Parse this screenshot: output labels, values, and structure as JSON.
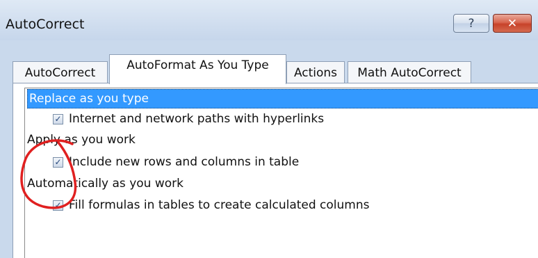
{
  "window": {
    "title": "AutoCorrect"
  },
  "titlebar_buttons": {
    "help_label": "?",
    "close_label": "✕"
  },
  "tabs": [
    {
      "label": "AutoCorrect",
      "active": false
    },
    {
      "label": "AutoFormat As You Type",
      "active": true
    },
    {
      "label": "Actions",
      "active": false
    },
    {
      "label": "Math AutoCorrect",
      "active": false
    }
  ],
  "list": {
    "sections": [
      {
        "header": "Replace as you type",
        "selected": true,
        "items": [
          {
            "label": "Internet and network paths with hyperlinks",
            "checked": true
          }
        ]
      },
      {
        "header": "Apply as you work",
        "selected": false,
        "items": [
          {
            "label": "Include new rows and columns in table",
            "checked": true
          }
        ]
      },
      {
        "header": "Automatically as you work",
        "selected": false,
        "items": [
          {
            "label": "Fill formulas in tables to create calculated columns",
            "checked": true
          }
        ]
      }
    ]
  },
  "checkbox_glyph": "✓",
  "colors": {
    "selection": "#3399ff",
    "annotation": "#e02020",
    "close_button": "#c7432a"
  }
}
